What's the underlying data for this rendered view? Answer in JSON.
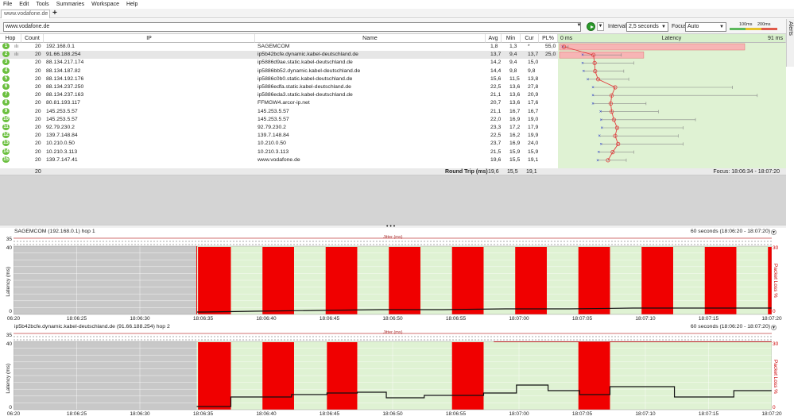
{
  "menu": [
    "File",
    "Edit",
    "Tools",
    "Summaries",
    "Workspace",
    "Help"
  ],
  "tab": {
    "label": "www.vodafone.de",
    "add": "+"
  },
  "alerts_label": "Alerts",
  "toolbar": {
    "target": "www.vodafone.de",
    "interval_label": "Interval",
    "interval_value": "2,5 seconds",
    "focus_label": "Focus",
    "focus_value": "Auto",
    "legend_100": "100ms",
    "legend_200": "200ms"
  },
  "columns": {
    "hop": "Hop",
    "count": "Count",
    "ip": "IP",
    "name": "Name",
    "avg": "Avg",
    "min": "Min",
    "cur": "Cur",
    "pl": "PL%",
    "lat_min": "0 ms",
    "latency": "Latency",
    "lat_max": "91 ms"
  },
  "hops": [
    {
      "hop": "1",
      "count": "20",
      "ip": "192.168.0.1",
      "name": "SAGEMCOM",
      "avg": "1,8",
      "min": "1,3",
      "cur": "*",
      "pl": "55,0",
      "avg_ms": 1.8,
      "min_ms": 1.3,
      "max_ms": 3.5,
      "plv": 55,
      "hl": true
    },
    {
      "hop": "2",
      "count": "20",
      "ip": "91.66.188.254",
      "name": "ip5b42bcfe.dynamic.kabel-deutschland.de",
      "avg": "13,7",
      "min": "9,4",
      "cur": "13,7",
      "pl": "25,0",
      "avg_ms": 13.7,
      "min_ms": 9.4,
      "max_ms": 25,
      "plv": 25,
      "hl": true
    },
    {
      "hop": "3",
      "count": "20",
      "ip": "88.134.217.174",
      "name": "ip5886d9ae.static.kabel-deutschland.de",
      "avg": "14,2",
      "min": "9,4",
      "cur": "15,0",
      "pl": "",
      "avg_ms": 14.2,
      "min_ms": 9.4,
      "max_ms": 30,
      "plv": 0
    },
    {
      "hop": "4",
      "count": "20",
      "ip": "88.134.187.82",
      "name": "ip5886bb52.dynamic.kabel-deutschland.de",
      "avg": "14,4",
      "min": "9,8",
      "cur": "9,8",
      "pl": "",
      "avg_ms": 14.4,
      "min_ms": 9.8,
      "max_ms": 26,
      "plv": 0
    },
    {
      "hop": "5",
      "count": "20",
      "ip": "88.134.192.176",
      "name": "ip5886c0b0.static.kabel-deutschland.de",
      "avg": "15,6",
      "min": "11,5",
      "cur": "13,8",
      "pl": "",
      "avg_ms": 15.6,
      "min_ms": 11.5,
      "max_ms": 28,
      "plv": 0
    },
    {
      "hop": "6",
      "count": "20",
      "ip": "88.134.237.250",
      "name": "ip5886edfa.static.kabel-deutschland.de",
      "avg": "22,5",
      "min": "13,6",
      "cur": "27,8",
      "pl": "",
      "avg_ms": 22.5,
      "min_ms": 13.6,
      "max_ms": 70,
      "plv": 0
    },
    {
      "hop": "7",
      "count": "20",
      "ip": "88.134.237.163",
      "name": "ip5886eda3.static.kabel-deutschland.de",
      "avg": "21,1",
      "min": "13,6",
      "cur": "20,9",
      "pl": "",
      "avg_ms": 21.1,
      "min_ms": 13.6,
      "max_ms": 80,
      "plv": 0
    },
    {
      "hop": "8",
      "count": "20",
      "ip": "80.81.193.117",
      "name": "FFMGW4.arcor-ip.net",
      "avg": "20,7",
      "min": "13,6",
      "cur": "17,6",
      "pl": "",
      "avg_ms": 20.7,
      "min_ms": 13.6,
      "max_ms": 35,
      "plv": 0
    },
    {
      "hop": "9",
      "count": "20",
      "ip": "145.253.5.57",
      "name": "145.253.5.57",
      "avg": "21,1",
      "min": "16,7",
      "cur": "16,7",
      "pl": "",
      "avg_ms": 21.1,
      "min_ms": 16.7,
      "max_ms": 40,
      "plv": 0
    },
    {
      "hop": "10",
      "count": "20",
      "ip": "145.253.5.57",
      "name": "145.253.5.57",
      "avg": "22,0",
      "min": "16,9",
      "cur": "19,0",
      "pl": "",
      "avg_ms": 22.0,
      "min_ms": 16.9,
      "max_ms": 55,
      "plv": 0
    },
    {
      "hop": "11",
      "count": "20",
      "ip": "92.79.230.2",
      "name": "92.79.230.2",
      "avg": "23,3",
      "min": "17,2",
      "cur": "17,9",
      "pl": "",
      "avg_ms": 23.3,
      "min_ms": 17.2,
      "max_ms": 50,
      "plv": 0
    },
    {
      "hop": "12",
      "count": "20",
      "ip": "139.7.148.84",
      "name": "139.7.148.84",
      "avg": "22,5",
      "min": "16,2",
      "cur": "19,9",
      "pl": "",
      "avg_ms": 22.5,
      "min_ms": 16.2,
      "max_ms": 48,
      "plv": 0
    },
    {
      "hop": "13",
      "count": "20",
      "ip": "10.210.0.50",
      "name": "10.210.0.50",
      "avg": "23,7",
      "min": "16,9",
      "cur": "24,0",
      "pl": "",
      "avg_ms": 23.7,
      "min_ms": 16.9,
      "max_ms": 50,
      "plv": 0
    },
    {
      "hop": "14",
      "count": "20",
      "ip": "10.210.3.113",
      "name": "10.210.3.113",
      "avg": "21,5",
      "min": "15,9",
      "cur": "15,9",
      "pl": "",
      "avg_ms": 21.5,
      "min_ms": 15.9,
      "max_ms": 30,
      "plv": 0
    },
    {
      "hop": "15",
      "count": "20",
      "ip": "139.7.147.41",
      "name": "www.vodafone.de",
      "avg": "19,6",
      "min": "15,5",
      "cur": "19,1",
      "pl": "",
      "avg_ms": 19.6,
      "min_ms": 15.5,
      "max_ms": 27,
      "plv": 0
    }
  ],
  "summary": {
    "count": "20",
    "label": "Round Trip (ms)",
    "avg": "19,6",
    "min": "15,5",
    "cur": "19,1",
    "focus": "Focus: 18:06:34 - 18:07:20"
  },
  "chart1": {
    "title": "SAGEMCOM (192.168.0.1) hop 1",
    "range": "60 seconds (18:06:20 - 18:07:20)",
    "jitter": "Jitter (ms)",
    "y_top": "35",
    "y_max": "40",
    "y_min": "0",
    "pl_max": "30",
    "pl_min": "0",
    "ylabel": "Latency (ms)",
    "ylabelr": "Packet Loss %"
  },
  "chart2": {
    "title": "ip5b42bcfe.dynamic.kabel-deutschland.de (91.66.188.254) hop 2",
    "range": "60 seconds (18:06:20 - 18:07:20)",
    "jitter": "Jitter (ms)",
    "y_top": "35",
    "y_max": "40",
    "y_min": "0",
    "pl_max": "30",
    "pl_min": "0",
    "ylabel": "Latency (ms)",
    "ylabelr": "Packet Loss %"
  },
  "x_ticks": [
    "06:20",
    "18:06:25",
    "18:06:30",
    "18:06:35",
    "18:06:40",
    "18:06:45",
    "18:06:50",
    "18:06:55",
    "18:07:00",
    "18:07:05",
    "18:07:10",
    "18:07:15",
    "18:07:20"
  ],
  "chart_data": [
    {
      "type": "bar",
      "title": "SAGEMCOM (192.168.0.1) hop 1",
      "ylabel": "Latency (ms)",
      "ylim": [
        0,
        40
      ],
      "loss_x": [
        18.06375,
        18.06425,
        18.06475,
        18.06525,
        18.06575,
        18.06625,
        18.06675,
        18.06725,
        18.06775,
        18.06825
      ],
      "latency_steps": [
        [
          35,
          1
        ],
        [
          40,
          2
        ],
        [
          45,
          2
        ],
        [
          50,
          2
        ],
        [
          55,
          2
        ],
        [
          60,
          2
        ],
        [
          65,
          2
        ],
        [
          70,
          2
        ],
        [
          75,
          3
        ],
        [
          80,
          3
        ]
      ]
    },
    {
      "type": "bar",
      "title": "ip5b42bcfe.dynamic.kabel-deutschland.de (91.66.188.254) hop 2",
      "ylabel": "Latency (ms)",
      "ylim": [
        0,
        40
      ],
      "loss_x": [
        18.0637,
        18.0645,
        18.06575,
        18.0671
      ]
    }
  ]
}
